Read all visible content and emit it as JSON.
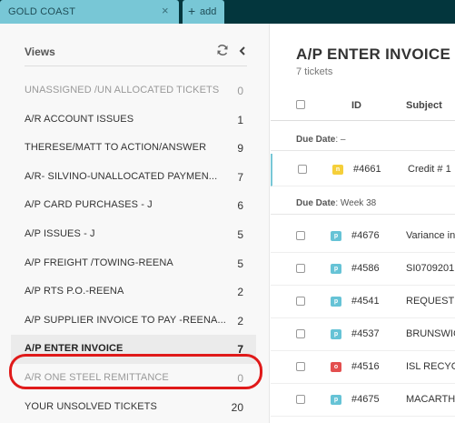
{
  "tabs": {
    "active_tab_label": "GOLD COAST",
    "close_symbol": "×",
    "add_symbol": "+",
    "add_label": "add"
  },
  "sidebar": {
    "title": "Views",
    "items": [
      {
        "label": "UNASSIGNED /UN ALLOCATED TICKETS",
        "count": "0",
        "muted": true
      },
      {
        "label": "A/R ACCOUNT ISSUES",
        "count": "1",
        "muted": false
      },
      {
        "label": "THERESE/MATT TO ACTION/ANSWER",
        "count": "9",
        "muted": false
      },
      {
        "label": "A/R- SILVINO-UNALLOCATED PAYMEN...",
        "count": "7",
        "muted": false
      },
      {
        "label": "A/P CARD PURCHASES - J",
        "count": "6",
        "muted": false
      },
      {
        "label": "A/P ISSUES - J",
        "count": "5",
        "muted": false
      },
      {
        "label": "A/P FREIGHT /TOWING-REENA",
        "count": "5",
        "muted": false
      },
      {
        "label": "A/P RTS P.O.-REENA",
        "count": "2",
        "muted": false
      },
      {
        "label": "A/P SUPPLIER INVOICE TO PAY -REENA...",
        "count": "2",
        "muted": false
      },
      {
        "label": "A/P ENTER INVOICE",
        "count": "7",
        "muted": false,
        "selected": true
      },
      {
        "label": "A/R ONE STEEL REMITTANCE",
        "count": "0",
        "muted": true
      },
      {
        "label": "YOUR UNSOLVED TICKETS",
        "count": "20",
        "muted": false
      }
    ]
  },
  "main": {
    "title": "A/P ENTER INVOICE",
    "ticket_count": "7 tickets",
    "columns": {
      "id": "ID",
      "subject": "Subject"
    },
    "groups": [
      {
        "label": "Due Date",
        "value": " –"
      },
      {
        "label": "Due Date",
        "value": " Week 38"
      }
    ],
    "tickets": [
      {
        "status": "n",
        "id": "#4661",
        "subject": "Credit # 1"
      },
      {
        "status": "p",
        "id": "#4676",
        "subject": "Variance in"
      },
      {
        "status": "p",
        "id": "#4586",
        "subject": "SI0709201"
      },
      {
        "status": "p",
        "id": "#4541",
        "subject": "REQUESTIN"
      },
      {
        "status": "p",
        "id": "#4537",
        "subject": "BRUNSWIC"
      },
      {
        "status": "o",
        "id": "#4516",
        "subject": "ISL RECYC"
      },
      {
        "status": "p",
        "id": "#4675",
        "subject": "MACARTH"
      }
    ]
  },
  "colors": {
    "topbar": "#03363d",
    "tab": "#78c7d6",
    "highlight": "#e01a1a",
    "pending": "#66c3d6",
    "new": "#f5cf3a",
    "open": "#e34f4f"
  },
  "icons": [
    "close-icon",
    "plus-icon",
    "refresh-icon",
    "chevron-left-icon"
  ]
}
